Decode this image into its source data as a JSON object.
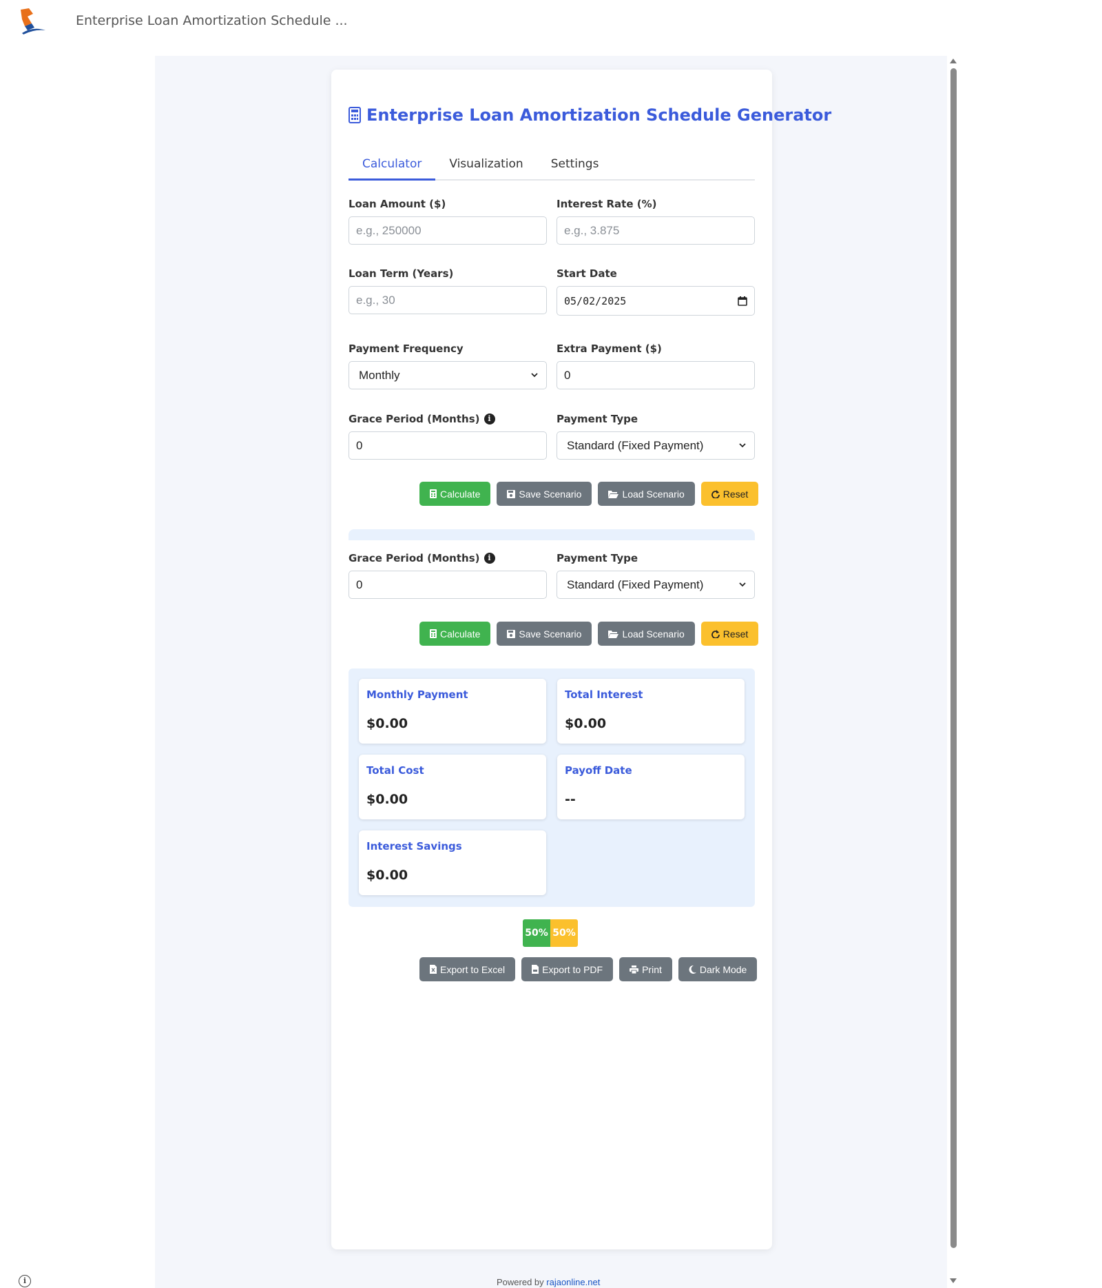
{
  "app": {
    "title": "Enterprise Loan Amortization Schedule ..."
  },
  "page": {
    "title": "Enterprise Loan Amortization Schedule Generator"
  },
  "tabs": [
    {
      "label": "Calculator",
      "active": true
    },
    {
      "label": "Visualization",
      "active": false
    },
    {
      "label": "Settings",
      "active": false
    }
  ],
  "form": {
    "loan_amount": {
      "label": "Loan Amount ($)",
      "placeholder": "e.g., 250000",
      "value": ""
    },
    "interest_rate": {
      "label": "Interest Rate (%)",
      "placeholder": "e.g., 3.875",
      "value": ""
    },
    "loan_term": {
      "label": "Loan Term (Years)",
      "placeholder": "e.g., 30",
      "value": ""
    },
    "start_date": {
      "label": "Start Date",
      "value": "05/02/2025"
    },
    "payment_frequency": {
      "label": "Payment Frequency",
      "value": "Monthly"
    },
    "extra_payment": {
      "label": "Extra Payment ($)",
      "value": "0"
    },
    "grace_period": {
      "label": "Grace Period (Months)",
      "value": "0"
    },
    "payment_type": {
      "label": "Payment Type",
      "value": "Standard (Fixed Payment)"
    }
  },
  "form2": {
    "grace_period": {
      "label": "Grace Period (Months)",
      "value": "0"
    },
    "payment_type": {
      "label": "Payment Type",
      "value": "Standard (Fixed Payment)"
    }
  },
  "actions": {
    "calculate": "Calculate",
    "save": "Save Scenario",
    "load": "Load Scenario",
    "reset": "Reset"
  },
  "results": {
    "monthly_payment": {
      "label": "Monthly Payment",
      "value": "$0.00"
    },
    "total_interest": {
      "label": "Total Interest",
      "value": "$0.00"
    },
    "total_cost": {
      "label": "Total Cost",
      "value": "$0.00"
    },
    "payoff_date": {
      "label": "Payoff Date",
      "value": "--"
    },
    "interest_savings": {
      "label": "Interest Savings",
      "value": "$0.00"
    }
  },
  "ratio": {
    "principal_label": "50%",
    "interest_label": "50%",
    "principal_fraction": 0.5
  },
  "export": {
    "excel": "Export to Excel",
    "pdf": "Export to PDF",
    "print": "Print",
    "dark": "Dark Mode"
  },
  "footer": {
    "prefix": "Powered by ",
    "link": "rajaonline.net"
  },
  "colors": {
    "accent": "#3b5bdb",
    "success": "#40b34f",
    "warning": "#fbc02d",
    "neutral": "#6c757d",
    "panel": "#e8f1fd"
  }
}
